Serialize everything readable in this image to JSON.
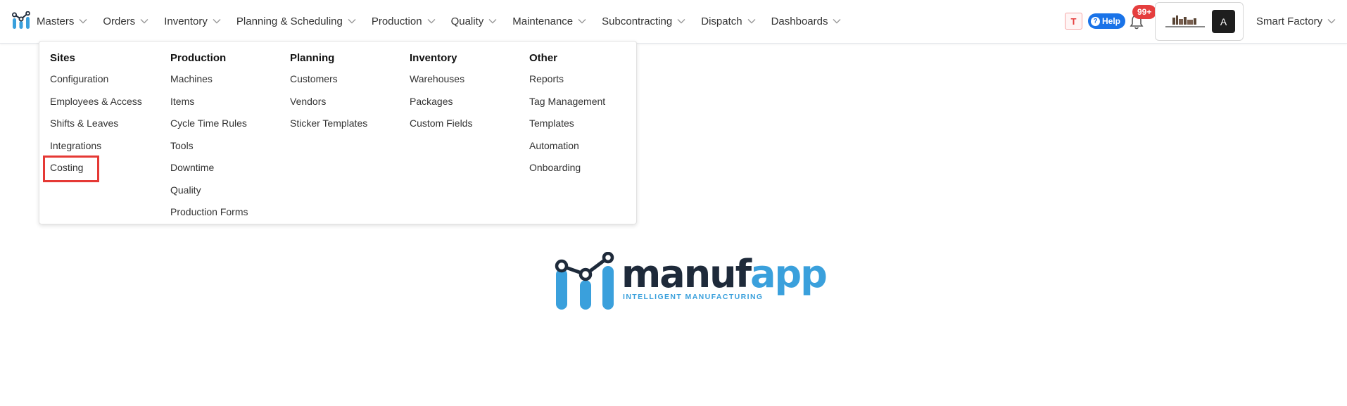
{
  "nav": {
    "items": [
      {
        "label": "Masters"
      },
      {
        "label": "Orders"
      },
      {
        "label": "Inventory"
      },
      {
        "label": "Planning & Scheduling"
      },
      {
        "label": "Production"
      },
      {
        "label": "Quality"
      },
      {
        "label": "Maintenance"
      },
      {
        "label": "Subcontracting"
      },
      {
        "label": "Dispatch"
      },
      {
        "label": "Dashboards"
      }
    ]
  },
  "header": {
    "t_badge": "T",
    "help_label": "Help",
    "notification_count": "99+",
    "avatar_initial": "A",
    "workspace": "Smart Factory"
  },
  "menu": {
    "columns": [
      {
        "heading": "Sites",
        "items": [
          "Configuration",
          "Employees & Access",
          "Shifts & Leaves",
          "Integrations",
          "Costing"
        ]
      },
      {
        "heading": "Production",
        "items": [
          "Machines",
          "Items",
          "Cycle Time Rules",
          "Tools",
          "Downtime",
          "Quality",
          "Production Forms"
        ]
      },
      {
        "heading": "Planning",
        "items": [
          "Customers",
          "Vendors",
          "Sticker Templates"
        ]
      },
      {
        "heading": "Inventory",
        "items": [
          "Warehouses",
          "Packages",
          "Custom Fields"
        ]
      },
      {
        "heading": "Other",
        "items": [
          "Reports",
          "Tag Management",
          "Templates",
          "Automation",
          "Onboarding"
        ]
      }
    ],
    "highlighted_item": "Costing"
  },
  "logo": {
    "word_dark": "manuf",
    "word_light": "app",
    "tagline": "INTELLIGENT MANUFACTURING"
  },
  "colors": {
    "brand_dark": "#1e2a3a",
    "brand_light": "#3aa0dc",
    "help_blue": "#1a73e8",
    "badge_red": "#e53e3e",
    "highlight_red": "#e53935"
  }
}
